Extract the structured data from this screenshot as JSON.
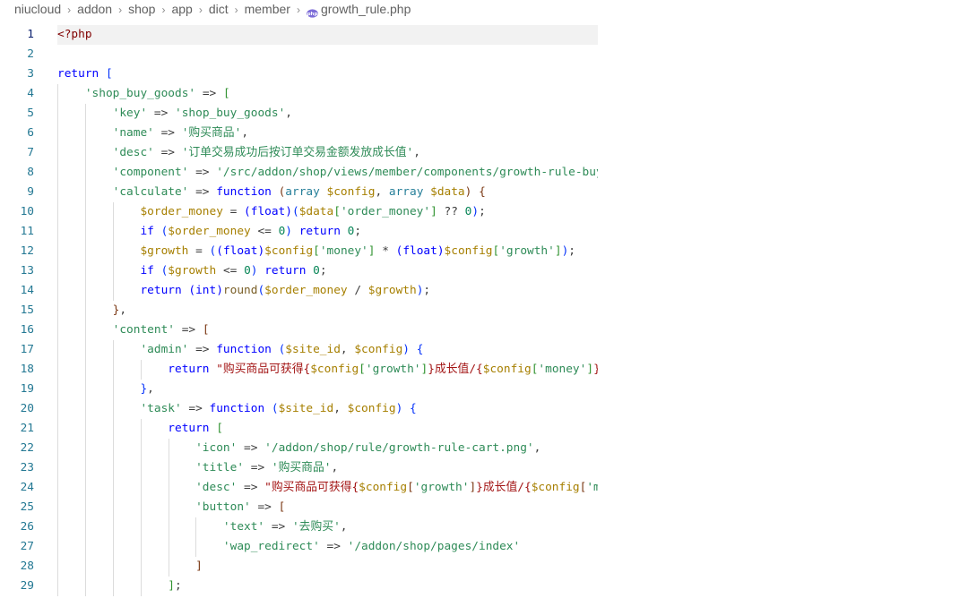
{
  "breadcrumb": {
    "items": [
      "niucloud",
      "addon",
      "shop",
      "app",
      "dict",
      "member"
    ],
    "file": "growth_rule.php"
  },
  "editor": {
    "current_line": 1,
    "lines": [
      {
        "n": "1",
        "indent": 0,
        "tokens": [
          [
            "<?php",
            "tag"
          ]
        ]
      },
      {
        "n": "2",
        "indent": 0,
        "tokens": []
      },
      {
        "n": "3",
        "indent": 0,
        "tokens": [
          [
            "return ",
            "kw"
          ],
          [
            "[",
            "br1"
          ]
        ]
      },
      {
        "n": "4",
        "indent": 1,
        "tokens": [
          [
            "'shop_buy_goods'",
            "key"
          ],
          [
            " => ",
            "punc"
          ],
          [
            "[",
            "br2"
          ]
        ]
      },
      {
        "n": "5",
        "indent": 2,
        "tokens": [
          [
            "'key'",
            "key"
          ],
          [
            " => ",
            "punc"
          ],
          [
            "'shop_buy_goods'",
            "key"
          ],
          [
            ",",
            "punc"
          ]
        ]
      },
      {
        "n": "6",
        "indent": 2,
        "tokens": [
          [
            "'name'",
            "key"
          ],
          [
            " => ",
            "punc"
          ],
          [
            "'购买商品'",
            "key"
          ],
          [
            ",",
            "punc"
          ]
        ]
      },
      {
        "n": "7",
        "indent": 2,
        "tokens": [
          [
            "'desc'",
            "key"
          ],
          [
            " => ",
            "punc"
          ],
          [
            "'订单交易成功后按订单交易金额发放成长值'",
            "key"
          ],
          [
            ",",
            "punc"
          ]
        ]
      },
      {
        "n": "8",
        "indent": 2,
        "tokens": [
          [
            "'component'",
            "key"
          ],
          [
            " => ",
            "punc"
          ],
          [
            "'/src/addon/shop/views/member/components/growth-rule-buy-goods.vue'",
            "key"
          ],
          [
            ",",
            "punc"
          ]
        ]
      },
      {
        "n": "9",
        "indent": 2,
        "tokens": [
          [
            "'calculate'",
            "key"
          ],
          [
            " => ",
            "punc"
          ],
          [
            "function ",
            "kw"
          ],
          [
            "(",
            "br3"
          ],
          [
            "array ",
            "type"
          ],
          [
            "$config",
            "var"
          ],
          [
            ", ",
            "punc"
          ],
          [
            "array ",
            "type"
          ],
          [
            "$data",
            "var"
          ],
          [
            ")",
            "br3"
          ],
          [
            " {",
            "br3"
          ]
        ]
      },
      {
        "n": "10",
        "indent": 3,
        "tokens": [
          [
            "$order_money",
            "var"
          ],
          [
            " = ",
            "punc"
          ],
          [
            "(float)",
            "kw"
          ],
          [
            "(",
            "br1"
          ],
          [
            "$data",
            "var"
          ],
          [
            "[",
            "br2"
          ],
          [
            "'order_money'",
            "key"
          ],
          [
            "]",
            "br2"
          ],
          [
            " ?? ",
            "punc"
          ],
          [
            "0",
            "num"
          ],
          [
            ")",
            "br1"
          ],
          [
            ";",
            "punc"
          ]
        ]
      },
      {
        "n": "11",
        "indent": 3,
        "tokens": [
          [
            "if ",
            "kw"
          ],
          [
            "(",
            "br1"
          ],
          [
            "$order_money",
            "var"
          ],
          [
            " <= ",
            "punc"
          ],
          [
            "0",
            "num"
          ],
          [
            ")",
            "br1"
          ],
          [
            " return ",
            "kw"
          ],
          [
            "0",
            "num"
          ],
          [
            ";",
            "punc"
          ]
        ]
      },
      {
        "n": "12",
        "indent": 3,
        "tokens": [
          [
            "$growth",
            "var"
          ],
          [
            " = ",
            "punc"
          ],
          [
            "(",
            "br1"
          ],
          [
            "(float)",
            "kw"
          ],
          [
            "$config",
            "var"
          ],
          [
            "[",
            "br2"
          ],
          [
            "'money'",
            "key"
          ],
          [
            "]",
            "br2"
          ],
          [
            " * ",
            "punc"
          ],
          [
            "(float)",
            "kw"
          ],
          [
            "$config",
            "var"
          ],
          [
            "[",
            "br2"
          ],
          [
            "'growth'",
            "key"
          ],
          [
            "]",
            "br2"
          ],
          [
            ")",
            "br1"
          ],
          [
            ";",
            "punc"
          ]
        ]
      },
      {
        "n": "13",
        "indent": 3,
        "tokens": [
          [
            "if ",
            "kw"
          ],
          [
            "(",
            "br1"
          ],
          [
            "$growth",
            "var"
          ],
          [
            " <= ",
            "punc"
          ],
          [
            "0",
            "num"
          ],
          [
            ")",
            "br1"
          ],
          [
            " return ",
            "kw"
          ],
          [
            "0",
            "num"
          ],
          [
            ";",
            "punc"
          ]
        ]
      },
      {
        "n": "14",
        "indent": 3,
        "tokens": [
          [
            "return ",
            "kw"
          ],
          [
            "(int)",
            "kw"
          ],
          [
            "round",
            "fn"
          ],
          [
            "(",
            "br1"
          ],
          [
            "$order_money",
            "var"
          ],
          [
            " / ",
            "punc"
          ],
          [
            "$growth",
            "var"
          ],
          [
            ")",
            "br1"
          ],
          [
            ";",
            "punc"
          ]
        ]
      },
      {
        "n": "15",
        "indent": 2,
        "tokens": [
          [
            "}",
            "br3"
          ],
          [
            ",",
            "punc"
          ]
        ]
      },
      {
        "n": "16",
        "indent": 2,
        "tokens": [
          [
            "'content'",
            "key"
          ],
          [
            " => ",
            "punc"
          ],
          [
            "[",
            "br3"
          ]
        ]
      },
      {
        "n": "17",
        "indent": 3,
        "tokens": [
          [
            "'admin'",
            "key"
          ],
          [
            " => ",
            "punc"
          ],
          [
            "function ",
            "kw"
          ],
          [
            "(",
            "br1"
          ],
          [
            "$site_id",
            "var"
          ],
          [
            ", ",
            "punc"
          ],
          [
            "$config",
            "var"
          ],
          [
            ")",
            "br1"
          ],
          [
            " {",
            "br1"
          ]
        ]
      },
      {
        "n": "18",
        "indent": 4,
        "tokens": [
          [
            "return ",
            "kw"
          ],
          [
            "\"购买商品可获得{",
            "str"
          ],
          [
            "$config",
            "var"
          ],
          [
            "[",
            "br2"
          ],
          [
            "'growth'",
            "key"
          ],
          [
            "]",
            "br2"
          ],
          [
            "}成长值/{",
            "str"
          ],
          [
            "$config",
            "var"
          ],
          [
            "[",
            "br2"
          ],
          [
            "'money'",
            "key"
          ],
          [
            "]",
            "br2"
          ],
          [
            "}元\";",
            "str"
          ]
        ]
      },
      {
        "n": "19",
        "indent": 3,
        "tokens": [
          [
            "}",
            "br1"
          ],
          [
            ",",
            "punc"
          ]
        ]
      },
      {
        "n": "20",
        "indent": 3,
        "tokens": [
          [
            "'task'",
            "key"
          ],
          [
            " => ",
            "punc"
          ],
          [
            "function ",
            "kw"
          ],
          [
            "(",
            "br1"
          ],
          [
            "$site_id",
            "var"
          ],
          [
            ", ",
            "punc"
          ],
          [
            "$config",
            "var"
          ],
          [
            ")",
            "br1"
          ],
          [
            " {",
            "br1"
          ]
        ]
      },
      {
        "n": "21",
        "indent": 4,
        "tokens": [
          [
            "return ",
            "kw"
          ],
          [
            "[",
            "br2"
          ]
        ]
      },
      {
        "n": "22",
        "indent": 5,
        "tokens": [
          [
            "'icon'",
            "key"
          ],
          [
            " => ",
            "punc"
          ],
          [
            "'/addon/shop/rule/growth-rule-cart.png'",
            "key"
          ],
          [
            ",",
            "punc"
          ]
        ]
      },
      {
        "n": "23",
        "indent": 5,
        "tokens": [
          [
            "'title'",
            "key"
          ],
          [
            " => ",
            "punc"
          ],
          [
            "'购买商品'",
            "key"
          ],
          [
            ",",
            "punc"
          ]
        ]
      },
      {
        "n": "24",
        "indent": 5,
        "tokens": [
          [
            "'desc'",
            "key"
          ],
          [
            " => ",
            "punc"
          ],
          [
            "\"购买商品可获得{",
            "str"
          ],
          [
            "$config",
            "var"
          ],
          [
            "[",
            "br3"
          ],
          [
            "'growth'",
            "key"
          ],
          [
            "]",
            "br3"
          ],
          [
            "}成长值/{",
            "str"
          ],
          [
            "$config",
            "var"
          ],
          [
            "[",
            "br3"
          ],
          [
            "'money'",
            "key"
          ],
          [
            "]",
            "br3"
          ],
          [
            "}元\",",
            "str"
          ]
        ]
      },
      {
        "n": "25",
        "indent": 5,
        "tokens": [
          [
            "'button'",
            "key"
          ],
          [
            " => ",
            "punc"
          ],
          [
            "[",
            "br3"
          ]
        ]
      },
      {
        "n": "26",
        "indent": 6,
        "tokens": [
          [
            "'text'",
            "key"
          ],
          [
            " => ",
            "punc"
          ],
          [
            "'去购买'",
            "key"
          ],
          [
            ",",
            "punc"
          ]
        ]
      },
      {
        "n": "27",
        "indent": 6,
        "tokens": [
          [
            "'wap_redirect'",
            "key"
          ],
          [
            " => ",
            "punc"
          ],
          [
            "'/addon/shop/pages/index'",
            "key"
          ]
        ]
      },
      {
        "n": "28",
        "indent": 5,
        "tokens": [
          [
            "]",
            "br3"
          ]
        ]
      },
      {
        "n": "29",
        "indent": 4,
        "tokens": [
          [
            "]",
            "br2"
          ],
          [
            ";",
            "punc"
          ]
        ]
      }
    ]
  }
}
